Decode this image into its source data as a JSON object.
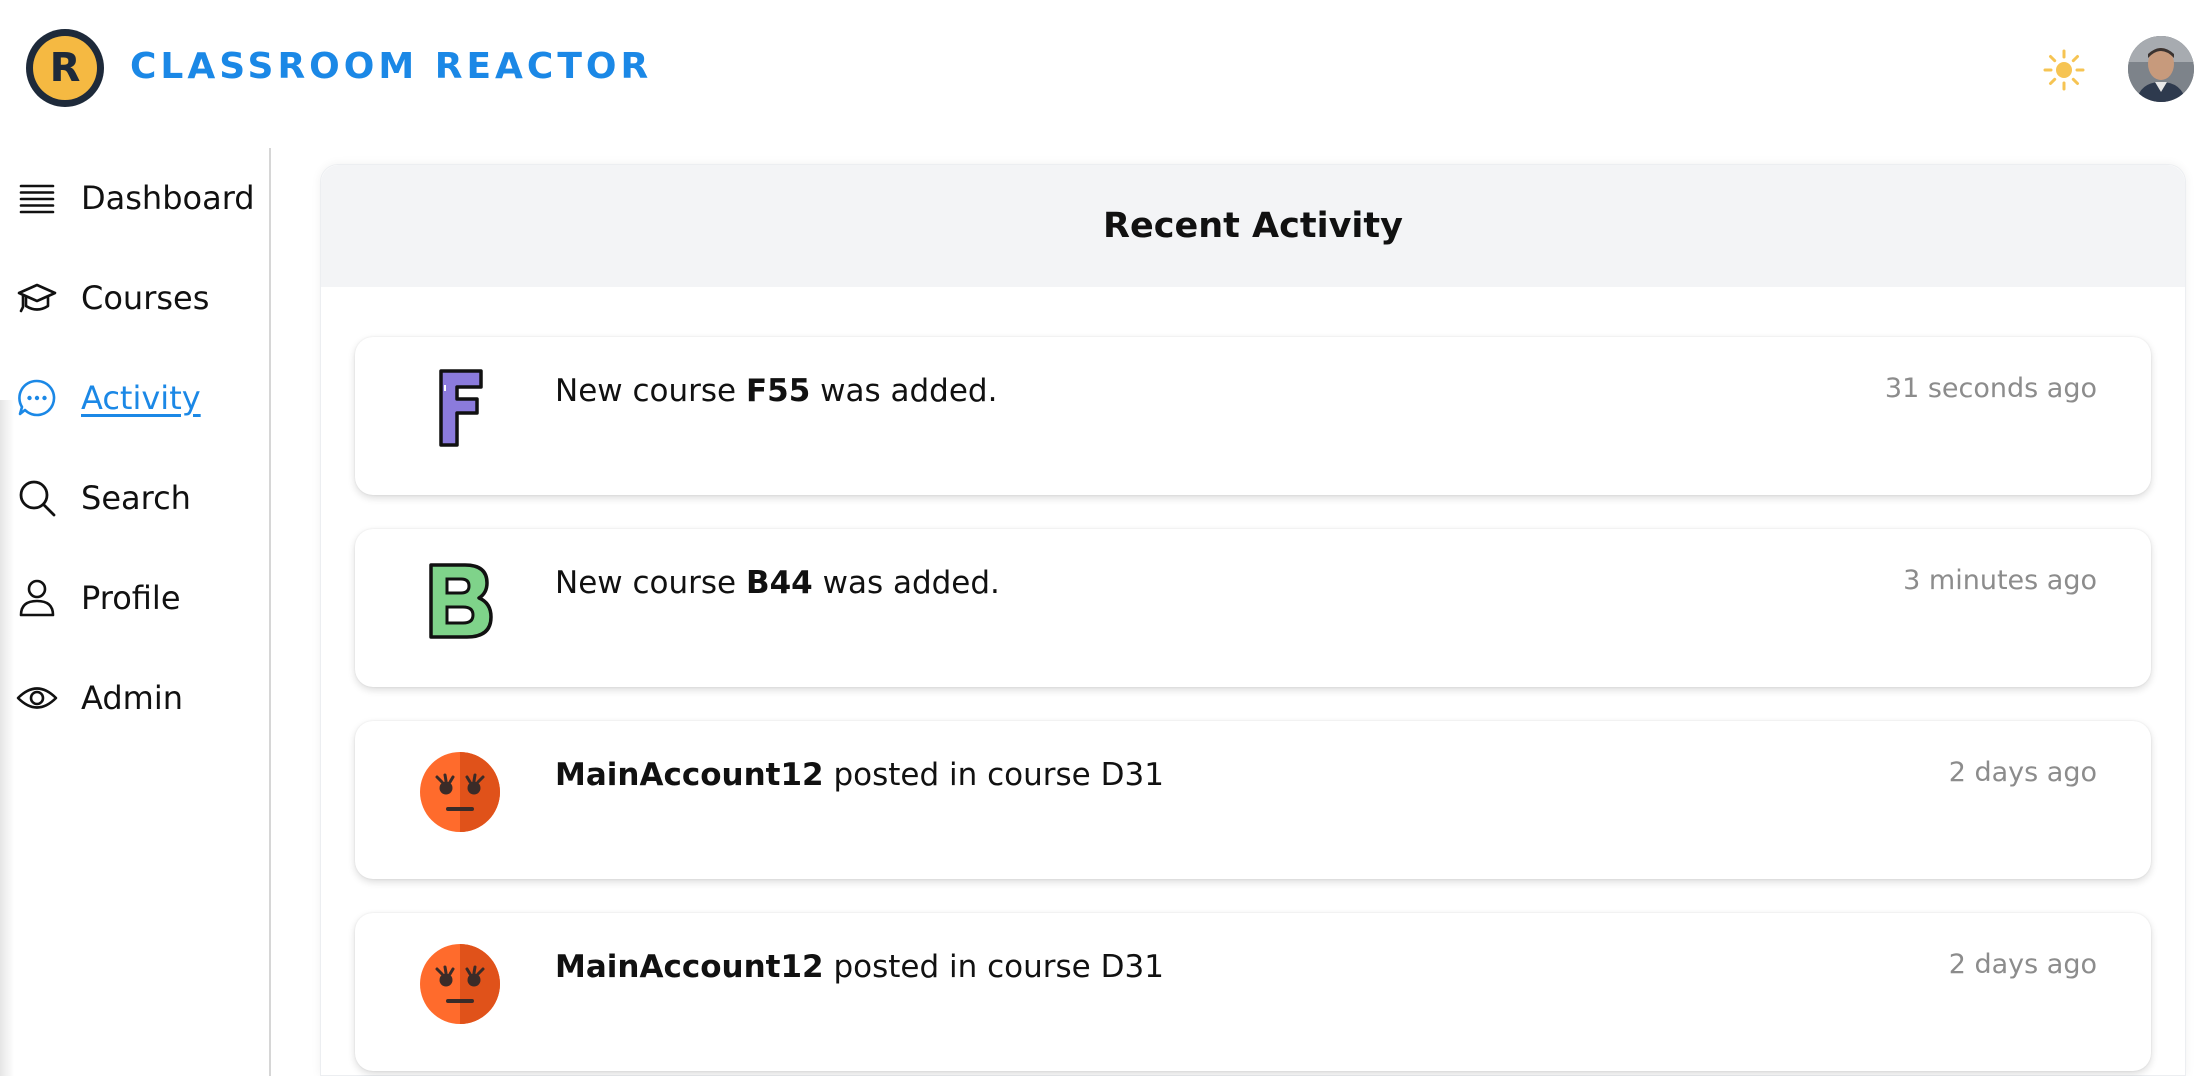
{
  "app": {
    "brand_letter": "R",
    "brand_name": "CLASSROOM REACTOR",
    "accent_color": "#1b88e6"
  },
  "header": {
    "theme_toggle_icon": "sun-icon",
    "avatar_icon": "user-photo-avatar"
  },
  "sidebar": {
    "items": [
      {
        "label": "Dashboard",
        "icon": "stacked-lines-icon",
        "active": false
      },
      {
        "label": "Courses",
        "icon": "graduation-cap-icon",
        "active": false
      },
      {
        "label": "Activity",
        "icon": "chat-bubble-icon",
        "active": true
      },
      {
        "label": "Search",
        "icon": "search-icon",
        "active": false
      },
      {
        "label": "Profile",
        "icon": "user-icon",
        "active": false
      },
      {
        "label": "Admin",
        "icon": "eye-icon",
        "active": false
      }
    ]
  },
  "main": {
    "title": "Recent Activity",
    "activities": [
      {
        "icon": "letter-f-icon",
        "letter": "F",
        "letter_color": "#8b7bdc",
        "pre": "New course ",
        "bold_first": false,
        "bold": "F55",
        "post": " was added.",
        "time": "31 seconds ago"
      },
      {
        "icon": "letter-b-icon",
        "letter": "B",
        "letter_color": "#7fd38a",
        "pre": "New course ",
        "bold_first": false,
        "bold": "B44",
        "post": " was added.",
        "time": "3 minutes ago"
      },
      {
        "icon": "grumpy-face-icon",
        "bold_first": true,
        "bold": "MainAccount12",
        "post": " posted in course D31",
        "time": "2 days ago"
      },
      {
        "icon": "grumpy-face-icon",
        "bold_first": true,
        "bold": "MainAccount12",
        "post": " posted in course D31",
        "time": "2 days ago"
      }
    ]
  }
}
